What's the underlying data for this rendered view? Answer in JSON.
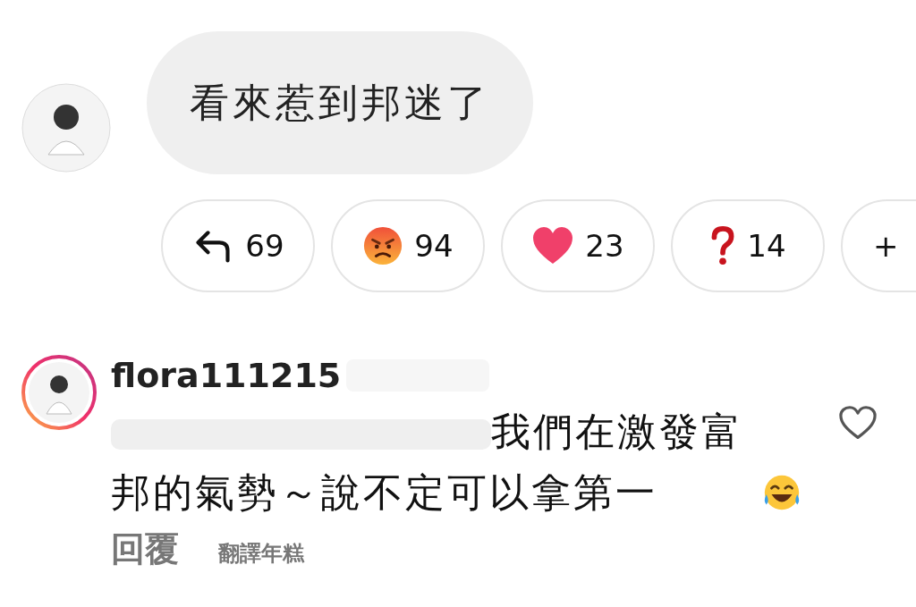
{
  "message": {
    "text": "看來惹到邦迷了"
  },
  "reactions": [
    {
      "kind": "reply",
      "count": "69"
    },
    {
      "kind": "angry",
      "count": "94"
    },
    {
      "kind": "heart",
      "count": "23"
    },
    {
      "kind": "question",
      "count": "14"
    },
    {
      "kind": "more",
      "count": "+"
    }
  ],
  "comment": {
    "username": "flora111215",
    "text": "我們在激發富邦的氣勢～說不定可以拿第一",
    "liked": false,
    "actions": [
      "回覆",
      "翻譯年糕"
    ]
  }
}
